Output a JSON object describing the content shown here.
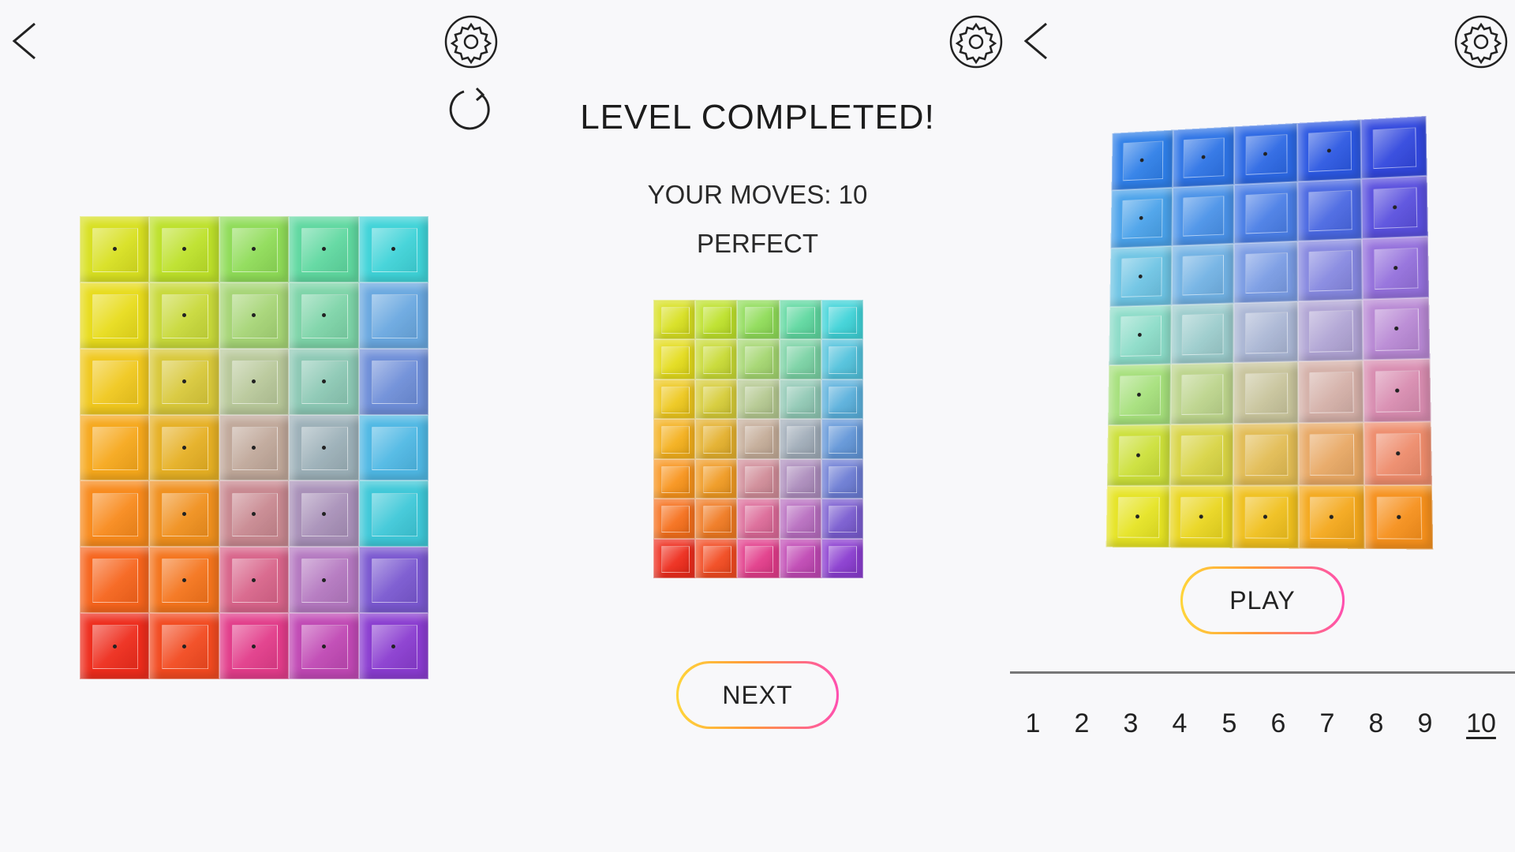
{
  "palette": {
    "background": "#f8f8fa",
    "button_gradient": [
      "#ffd53a",
      "#ff9a3a",
      "#ff4fb0"
    ],
    "divider": "#777777"
  },
  "left_panel": {
    "icons": [
      "back-arrow-icon",
      "settings-gear-icon",
      "restart-icon"
    ],
    "board": {
      "rows": 7,
      "cols": 5,
      "colors": [
        [
          "#d8e021",
          "#bde12a",
          "#8fdc58",
          "#5fd8a0",
          "#3fd3d8"
        ],
        [
          "#e8dc1c",
          "#c8d93a",
          "#a6d576",
          "#7dd4a8",
          "#6aa8e0"
        ],
        [
          "#f0c81e",
          "#d8c83a",
          "#b8c89a",
          "#8cc8b4",
          "#6e8ed8"
        ],
        [
          "#f6a81c",
          "#e6b024",
          "#c0a89a",
          "#9cb0b8",
          "#4fb8e4"
        ],
        [
          "#f88a1c",
          "#f0901e",
          "#c88890",
          "#a890b8",
          "#3ec8d8"
        ],
        [
          "#f6641c",
          "#f4741c",
          "#d8648a",
          "#b478c0",
          "#7a58d0"
        ],
        [
          "#ee2c1c",
          "#f24a20",
          "#e23c8a",
          "#c048b4",
          "#8a3cd0"
        ]
      ],
      "dots": [
        [
          true,
          true,
          true,
          true,
          true
        ],
        [
          false,
          true,
          true,
          true,
          false
        ],
        [
          false,
          true,
          true,
          true,
          false
        ],
        [
          false,
          true,
          true,
          true,
          false
        ],
        [
          false,
          true,
          true,
          true,
          false
        ],
        [
          false,
          true,
          true,
          true,
          false
        ],
        [
          true,
          true,
          true,
          true,
          true
        ]
      ]
    }
  },
  "middle_panel": {
    "icons": [
      "settings-gear-icon"
    ],
    "title": "LEVEL COMPLETED!",
    "moves": "YOUR MOVES: 10",
    "rating": "PERFECT",
    "next_label": "NEXT",
    "preview": {
      "rows": 7,
      "cols": 5,
      "colors": [
        [
          "#d8e021",
          "#bde12a",
          "#8fdc58",
          "#5fd8a0",
          "#3fd3d8"
        ],
        [
          "#e4dc1c",
          "#c8da34",
          "#a4d670",
          "#7ad2a4",
          "#52c2dc"
        ],
        [
          "#eec81e",
          "#d6cc38",
          "#b4c890",
          "#90c8b4",
          "#5ab0dc"
        ],
        [
          "#f4b01c",
          "#e4b02c",
          "#c4ac98",
          "#a0acb8",
          "#6296d8"
        ],
        [
          "#f8941c",
          "#f09a22",
          "#d08c98",
          "#ac8cbc",
          "#6c7cd4"
        ],
        [
          "#f6701c",
          "#f07a22",
          "#dc6a98",
          "#b86ec0",
          "#7a5cd0"
        ],
        [
          "#ee2c1c",
          "#f24a20",
          "#e23c8a",
          "#c048b4",
          "#8a3cd0"
        ]
      ]
    }
  },
  "right_panel": {
    "icons": [
      "back-arrow-icon",
      "settings-gear-icon"
    ],
    "board": {
      "rows": 7,
      "cols": 5,
      "colors": [
        [
          "#2f7fe8",
          "#2e74e6",
          "#2c68e4",
          "#2c58e2",
          "#3248de"
        ],
        [
          "#4aa2ea",
          "#4a92e8",
          "#4a7ee6",
          "#4a68e2",
          "#5a50de"
        ],
        [
          "#6ec4e4",
          "#72b2e4",
          "#7a9ce4",
          "#8688e0",
          "#9470dc"
        ],
        [
          "#8cdcc8",
          "#9ccccc",
          "#aab6d4",
          "#b0a4d4",
          "#b888d4"
        ],
        [
          "#a6e07c",
          "#bcd48c",
          "#c8c49c",
          "#d4b0a8",
          "#d88cb0"
        ],
        [
          "#cce03a",
          "#d8d444",
          "#e2bc54",
          "#e8a864",
          "#ee8c6c"
        ],
        [
          "#e6e424",
          "#ead620",
          "#f0c01e",
          "#f4a81c",
          "#f6901c"
        ]
      ],
      "dots": [
        [
          true,
          true,
          true,
          true,
          false
        ],
        [
          true,
          false,
          false,
          false,
          true
        ],
        [
          true,
          false,
          false,
          false,
          true
        ],
        [
          true,
          false,
          false,
          false,
          true
        ],
        [
          true,
          false,
          false,
          false,
          true
        ],
        [
          true,
          false,
          false,
          false,
          true
        ],
        [
          true,
          true,
          true,
          true,
          true
        ]
      ]
    },
    "play_label": "PLAY",
    "levels": [
      "1",
      "2",
      "3",
      "4",
      "5",
      "6",
      "7",
      "8",
      "9",
      "10"
    ],
    "current_level": "10"
  }
}
